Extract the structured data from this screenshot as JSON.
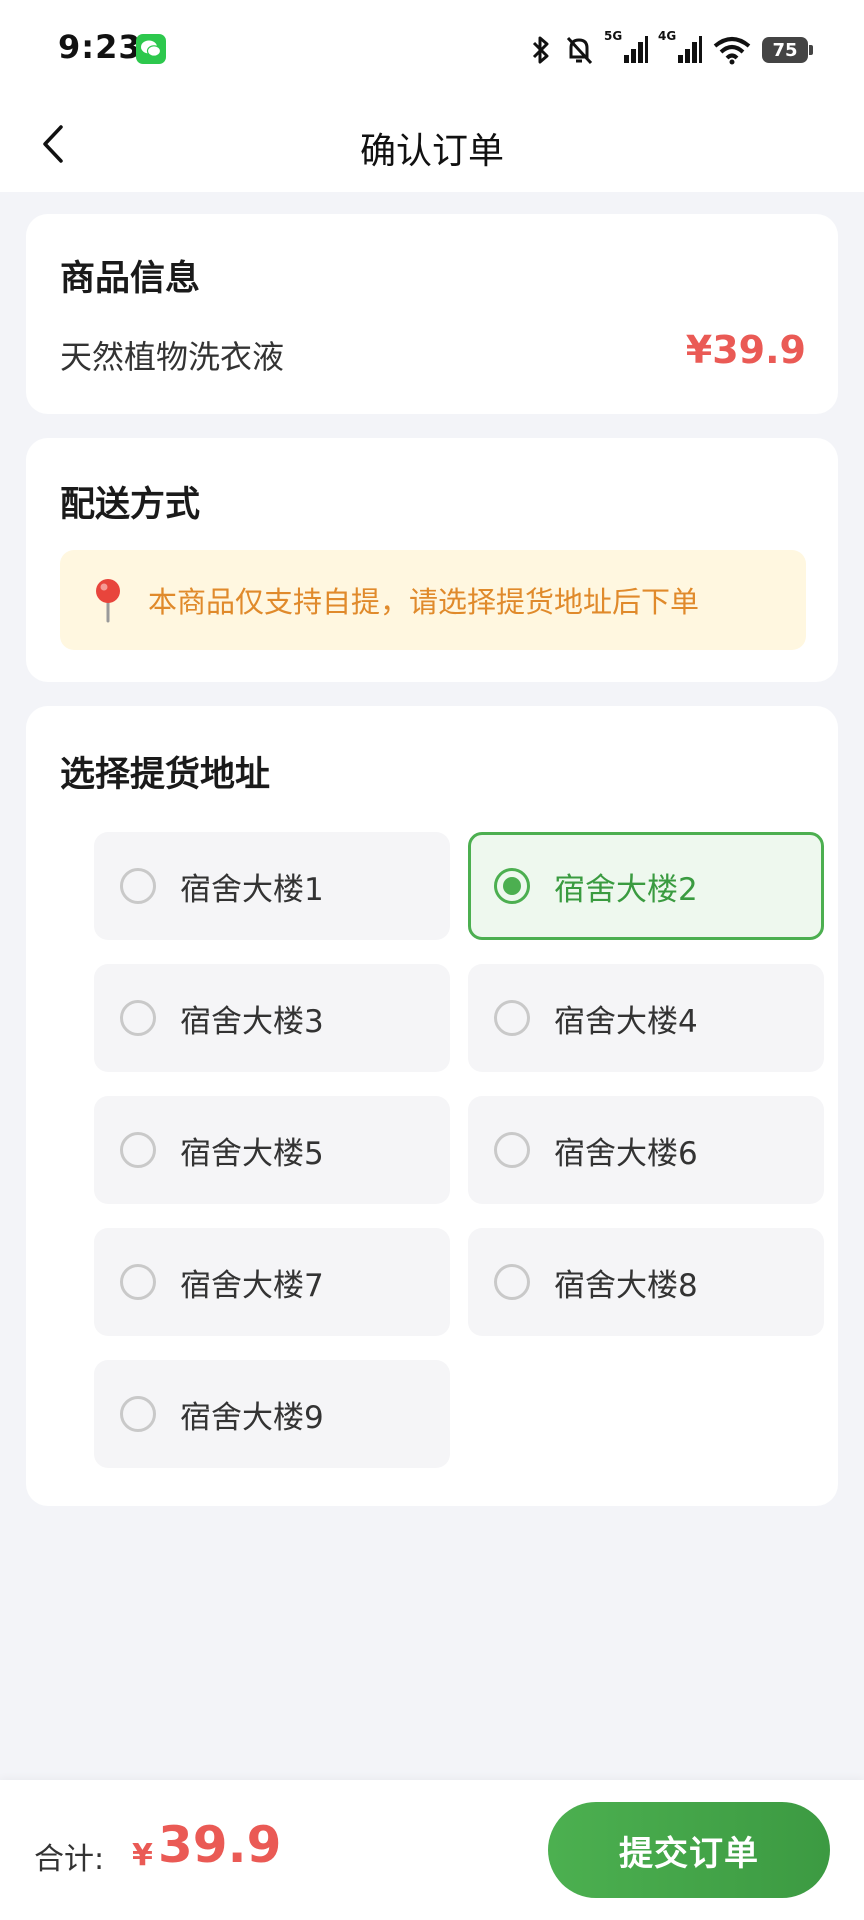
{
  "status_bar": {
    "time": "9:23",
    "signal_1_label": "5G",
    "signal_2_label": "4G",
    "battery": "75"
  },
  "nav": {
    "title": "确认订单"
  },
  "goods": {
    "section_title": "商品信息",
    "name": "天然植物洗衣液",
    "price": "¥39.9"
  },
  "delivery": {
    "section_title": "配送方式",
    "notice": "本商品仅支持自提，请选择提货地址后下单"
  },
  "address": {
    "section_title": "选择提货地址",
    "selected_index": 1,
    "options": [
      {
        "label": "宿舍大楼1",
        "selected": false
      },
      {
        "label": "宿舍大楼2",
        "selected": true
      },
      {
        "label": "宿舍大楼3",
        "selected": false
      },
      {
        "label": "宿舍大楼4",
        "selected": false
      },
      {
        "label": "宿舍大楼5",
        "selected": false
      },
      {
        "label": "宿舍大楼6",
        "selected": false
      },
      {
        "label": "宿舍大楼7",
        "selected": false
      },
      {
        "label": "宿舍大楼8",
        "selected": false
      },
      {
        "label": "宿舍大楼9",
        "selected": false
      }
    ]
  },
  "footer": {
    "total_label": "合计:",
    "currency": "¥",
    "total_amount": "39.9",
    "submit_label": "提交订单"
  },
  "colors": {
    "accent_green": "#4caf50",
    "price_red": "#ea5a55",
    "notice_bg": "#fff7e0",
    "notice_text": "#e08a2b"
  },
  "icons": {
    "back": "chevron-left-icon",
    "notice": "location-pin-icon",
    "status": [
      "wechat-icon",
      "bluetooth-icon",
      "mute-bell-icon",
      "signal-icon",
      "wifi-icon",
      "battery-icon"
    ]
  }
}
